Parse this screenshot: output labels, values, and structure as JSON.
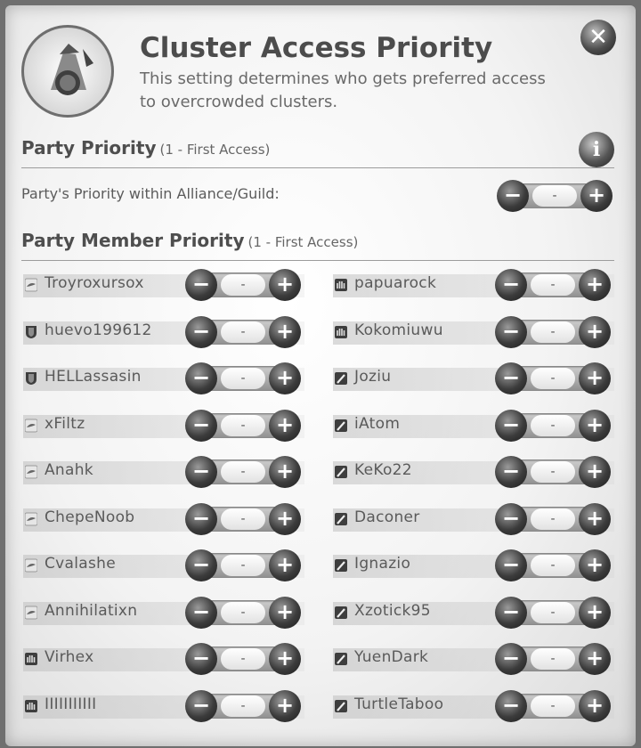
{
  "title": "Cluster Access Priority",
  "subtitle": "This setting determines who gets preferred access to overcrowded clusters.",
  "party_priority": {
    "label": "Party Priority",
    "note": "(1 - First Access)"
  },
  "alliance_label": "Party's Priority within Alliance/Guild:",
  "alliance_value": "-",
  "member_priority": {
    "label": "Party Member Priority",
    "note": "(1 - First Access)"
  },
  "members_left": [
    {
      "name": "Troyroxursox",
      "role_icon": "bird-icon",
      "value": "-"
    },
    {
      "name": "huevo199612",
      "role_icon": "shield-icon",
      "value": "-"
    },
    {
      "name": "HELLassasin",
      "role_icon": "shield-icon",
      "value": "-"
    },
    {
      "name": "xFiltz",
      "role_icon": "bird-icon",
      "value": "-"
    },
    {
      "name": "Anahk",
      "role_icon": "bird-icon",
      "value": "-"
    },
    {
      "name": "ChepeNoob",
      "role_icon": "bird-icon",
      "value": "-"
    },
    {
      "name": "Cvalashe",
      "role_icon": "bird-icon",
      "value": "-"
    },
    {
      "name": "Annihilatixn",
      "role_icon": "bird-icon",
      "value": "-"
    },
    {
      "name": "Virhex",
      "role_icon": "hand-icon",
      "value": "-"
    },
    {
      "name": "IIIIIIIIIII",
      "role_icon": "hand-icon",
      "value": "-"
    }
  ],
  "members_right": [
    {
      "name": "papuarock",
      "role_icon": "hand-icon",
      "value": "-"
    },
    {
      "name": "Kokomiuwu",
      "role_icon": "hand-icon",
      "value": "-"
    },
    {
      "name": "Joziu",
      "role_icon": "sword-icon",
      "value": "-"
    },
    {
      "name": "iAtom",
      "role_icon": "sword-icon",
      "value": "-"
    },
    {
      "name": "KeKo22",
      "role_icon": "sword-icon",
      "value": "-"
    },
    {
      "name": "Daconer",
      "role_icon": "sword-icon",
      "value": "-"
    },
    {
      "name": "Ignazio",
      "role_icon": "sword-icon",
      "value": "-"
    },
    {
      "name": "Xzotick95",
      "role_icon": "sword-icon",
      "value": "-"
    },
    {
      "name": "YuenDark",
      "role_icon": "sword-icon",
      "value": "-"
    },
    {
      "name": "TurtleTaboo",
      "role_icon": "sword-icon",
      "value": "-"
    }
  ],
  "icons": {
    "close": "close-icon",
    "info": "info-icon",
    "minus": "minus-icon",
    "plus": "plus-icon"
  }
}
